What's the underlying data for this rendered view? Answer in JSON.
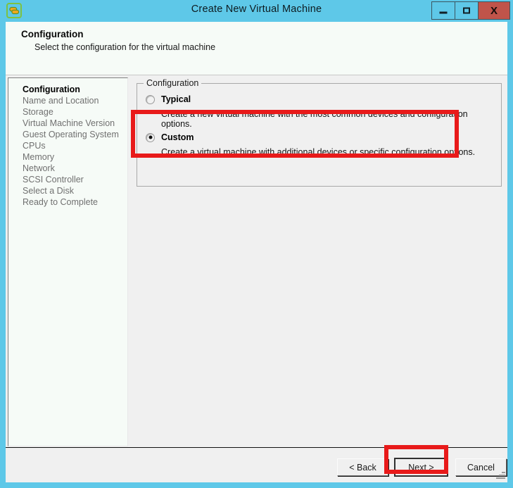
{
  "window": {
    "title": "Create New Virtual Machine",
    "app_icon": "vsphere-link-icon",
    "controls": {
      "minimize_label": "–",
      "maximize_label": "□",
      "close_label": "X",
      "minimize_name": "minimize",
      "maximize_name": "maximize",
      "close_name": "close"
    },
    "accent_title_bg": "#5ec8e8",
    "close_bg": "#c0544a"
  },
  "header": {
    "title": "Configuration",
    "subtitle": "Select the configuration for the virtual machine"
  },
  "sidebar": {
    "items": [
      {
        "label": "Configuration",
        "active": true
      },
      {
        "label": "Name and Location",
        "active": false
      },
      {
        "label": "Storage",
        "active": false
      },
      {
        "label": "Virtual Machine Version",
        "active": false
      },
      {
        "label": "Guest Operating System",
        "active": false
      },
      {
        "label": "CPUs",
        "active": false
      },
      {
        "label": "Memory",
        "active": false
      },
      {
        "label": "Network",
        "active": false
      },
      {
        "label": "SCSI Controller",
        "active": false
      },
      {
        "label": "Select a Disk",
        "active": false
      },
      {
        "label": "Ready to Complete",
        "active": false
      }
    ]
  },
  "main": {
    "groupbox_legend": "Configuration",
    "options": [
      {
        "label": "Typical",
        "description": "Create a new virtual machine with the most common devices and configuration options.",
        "selected": false
      },
      {
        "label": "Custom",
        "description": "Create a virtual machine with additional devices or specific configuration options.",
        "selected": true
      }
    ]
  },
  "footer": {
    "back_label": "< Back",
    "next_label": "Next >",
    "cancel_label": "Cancel"
  },
  "annotations": {
    "color": "#e81a1a",
    "targets": [
      "custom-option-row",
      "next-button"
    ]
  }
}
